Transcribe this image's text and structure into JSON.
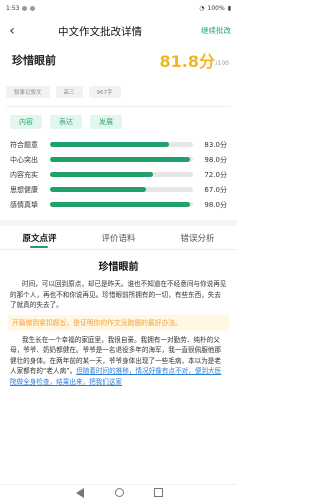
{
  "status": {
    "time": "1:53",
    "battery": "100%"
  },
  "nav": {
    "title": "中文作文批改详情",
    "action": "继续批改"
  },
  "essay": {
    "title": "珍惜眼前",
    "score": "81.8分",
    "max": "/100",
    "tags": [
      "叙事记叙文",
      "高三",
      "967字"
    ]
  },
  "categories": [
    "内容",
    "表达",
    "发展"
  ],
  "metrics": [
    {
      "label": "符合题意",
      "value": "83.0分",
      "pct": 83
    },
    {
      "label": "中心突出",
      "value": "98.0分",
      "pct": 98
    },
    {
      "label": "内容充实",
      "value": "72.0分",
      "pct": 72
    },
    {
      "label": "思想健康",
      "value": "67.0分",
      "pct": 67
    },
    {
      "label": "感情真挚",
      "value": "98.0分",
      "pct": 98
    }
  ],
  "tabs": [
    "原文点评",
    "评价语料",
    "错误分析"
  ],
  "article": {
    "title": "珍惜眼前",
    "p1": "时间，可以回到原点，却已是昨天。谁也不知道在不经意间与你说再见的那个人，再也不和你说再见。珍惜眼前所拥有的一切，有些东西，失去了就真的失去了。",
    "note": "开篇做到紧扣题旨，是证明你的作文没跑题的最好办法。",
    "p2": "我生长在一个幸福的家庭里，我很自豪。我拥有一对勤劳、纯朴的父母，爷爷、奶奶都健在。爷爷是一名退役多年的海军，我一直很佩服他那健壮的身体。在两年前的某一天，爷爷身体出现了一些毛病，本以为是老人家都有的“老人病”。",
    "p2_link": "但随着时间的推移，情况好像有点不对，便到大医院做全身检查，结果出来，把我们这家"
  }
}
